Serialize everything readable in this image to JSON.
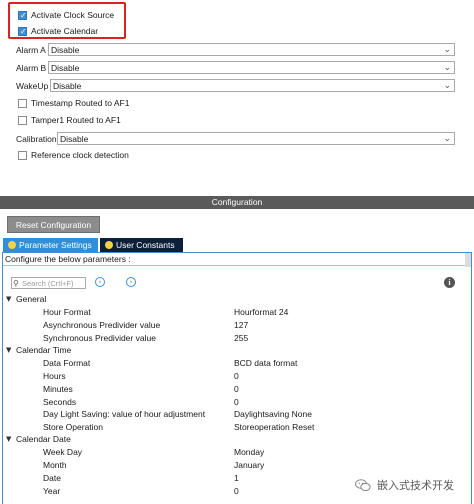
{
  "mode": {
    "activate_clock_source": {
      "label": "Activate Clock Source",
      "checked": true
    },
    "activate_calendar": {
      "label": "Activate Calendar",
      "checked": true
    },
    "alarm_a": {
      "label": "Alarm A",
      "value": "Disable"
    },
    "alarm_b": {
      "label": "Alarm B",
      "value": "Disable"
    },
    "wakeup": {
      "label": "WakeUp",
      "value": "Disable"
    },
    "timestamp_af1": {
      "label": "Timestamp Routed to AF1",
      "checked": false
    },
    "tamper1_af1": {
      "label": "Tamper1 Routed to AF1",
      "checked": false
    },
    "calibration": {
      "label": "Calibration",
      "value": "Disable"
    },
    "reference_clock": {
      "label": "Reference clock detection",
      "checked": false
    }
  },
  "configuration": {
    "title": "Configuration",
    "reset_button": "Reset Configuration",
    "tabs": [
      {
        "label": "Parameter Settings",
        "active": true
      },
      {
        "label": "User Constants",
        "active": false
      }
    ],
    "hint": "Configure the below parameters :",
    "search_placeholder": "Search (Crtl+F)"
  },
  "parameters": {
    "general": {
      "title": "General",
      "items": [
        {
          "name": "Hour Format",
          "value": "Hourformat 24"
        },
        {
          "name": "Asynchronous Predivider value",
          "value": "127"
        },
        {
          "name": "Synchronous Predivider value",
          "value": "255"
        }
      ]
    },
    "calendar_time": {
      "title": "Calendar Time",
      "items": [
        {
          "name": "Data Format",
          "value": "BCD data format"
        },
        {
          "name": "Hours",
          "value": "0"
        },
        {
          "name": "Minutes",
          "value": "0"
        },
        {
          "name": "Seconds",
          "value": "0"
        },
        {
          "name": "Day Light Saving: value of hour adjustment",
          "value": "Daylightsaving None"
        },
        {
          "name": "Store Operation",
          "value": "Storeoperation Reset"
        }
      ]
    },
    "calendar_date": {
      "title": "Calendar Date",
      "items": [
        {
          "name": "Week Day",
          "value": "Monday"
        },
        {
          "name": "Month",
          "value": "January"
        },
        {
          "name": "Date",
          "value": "1"
        },
        {
          "name": "Year",
          "value": "0"
        }
      ]
    }
  },
  "watermark": {
    "text": "嵌入式技术开发"
  },
  "colors": {
    "accent": "#3f8fd6",
    "highlight": "#e02020",
    "header_bar": "#5a5a5a",
    "tab_dark": "#0e1f3a"
  }
}
